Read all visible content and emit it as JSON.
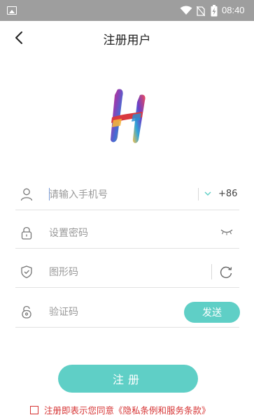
{
  "status_bar": {
    "time": "08:40",
    "icons": [
      "gallery-icon",
      "wifi-icon",
      "no-sim-icon",
      "battery-charging-icon"
    ]
  },
  "header": {
    "title": "注册用户",
    "back_icon": "chevron-left-icon"
  },
  "form": {
    "phone": {
      "placeholder": "请输入手机号",
      "country_code": "+86",
      "icon": "user-icon"
    },
    "password": {
      "placeholder": "设置密码",
      "icon": "lock-icon",
      "toggle_icon": "eye-closed-icon"
    },
    "captcha": {
      "placeholder": "图形码",
      "icon": "shield-icon",
      "refresh_icon": "refresh-icon"
    },
    "sms_code": {
      "placeholder": "验证码",
      "icon": "lock-open-icon",
      "send_label": "发送"
    }
  },
  "actions": {
    "register_label": "注册"
  },
  "agreement": {
    "prefix": "注册即表示您同意",
    "link_text": "《隐私条例和服务条款》"
  },
  "colors": {
    "accent": "#5fcfc6",
    "warning": "#d63434",
    "status_bar": "#9e9e9e"
  }
}
